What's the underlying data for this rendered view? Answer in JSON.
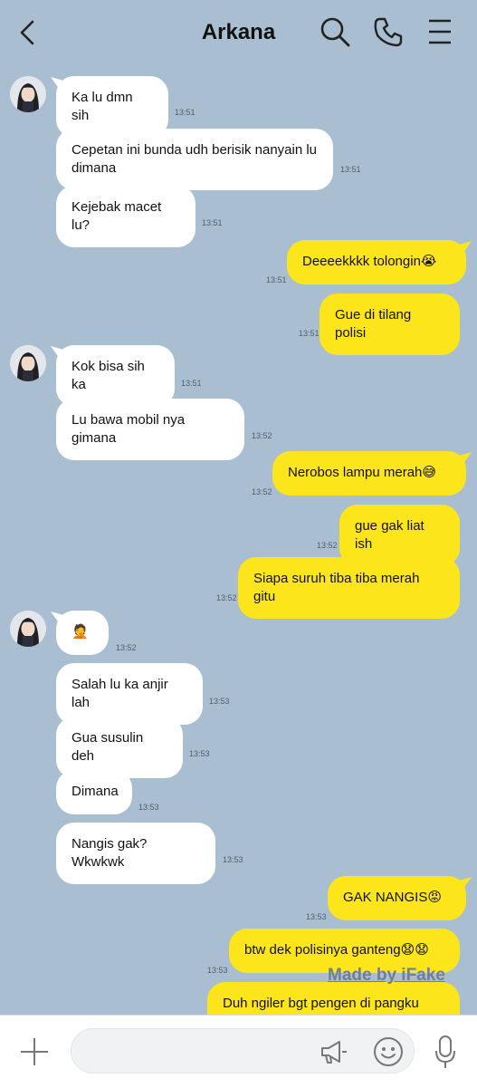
{
  "header": {
    "title": "Arkana"
  },
  "messages": [
    {
      "side": "left",
      "text": "Ka lu dmn sih",
      "time": "13:51",
      "avatar": true
    },
    {
      "side": "left",
      "text": "Cepetan ini bunda udh berisik nanyain lu\ndimana",
      "time": "13:51"
    },
    {
      "side": "left",
      "text": "Kejebak macet lu?",
      "time": "13:51"
    },
    {
      "side": "right",
      "text": "Deeeekkkk tolongin😭",
      "time": "13:51"
    },
    {
      "side": "right",
      "text": "Gue di tilang polisi",
      "time": "13:51"
    },
    {
      "side": "left",
      "text": "Kok bisa sih ka",
      "time": "13:51",
      "avatar": true
    },
    {
      "side": "left",
      "text": "Lu bawa mobil nya gimana",
      "time": "13:52"
    },
    {
      "side": "right",
      "text": "Nerobos lampu merah😅",
      "time": "13:52"
    },
    {
      "side": "right",
      "text": "gue gak liat ish",
      "time": "13:52"
    },
    {
      "side": "right",
      "text": "Siapa suruh tiba tiba merah gitu",
      "time": "13:52"
    },
    {
      "side": "left",
      "text": "🤦",
      "time": "13:52",
      "avatar": true
    },
    {
      "side": "left",
      "text": "Salah lu ka anjir lah",
      "time": "13:53"
    },
    {
      "side": "left",
      "text": "Gua susulin deh",
      "time": "13:53"
    },
    {
      "side": "left",
      "text": "Dimana",
      "time": "13:53"
    },
    {
      "side": "left",
      "text": "Nangis gak? Wkwkwk",
      "time": "13:53"
    },
    {
      "side": "right",
      "text": "GAK NANGIS😡",
      "time": "13:53"
    },
    {
      "side": "right",
      "text": "btw dek polisinya ganteng😧😧",
      "time": "13:53"
    },
    {
      "side": "right",
      "text": "Duh ngiler bgt pengen di pangku deh",
      "time": ""
    }
  ],
  "watermark": "Made by iFake",
  "input": {
    "placeholder": ""
  },
  "icons": {
    "back": "back-arrow-icon",
    "search": "search-icon",
    "call": "phone-icon",
    "menu": "menu-icon",
    "plus": "plus-icon",
    "megaphone": "megaphone-icon",
    "emoji": "emoji-icon",
    "mic": "microphone-icon"
  },
  "colors": {
    "background": "#a9bfd1",
    "my_bubble": "#fce51a",
    "their_bubble": "#ffffff"
  }
}
